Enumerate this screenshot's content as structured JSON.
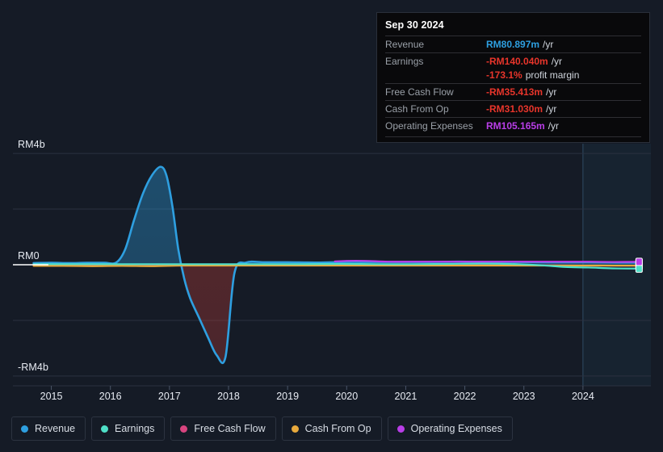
{
  "chart_data": {
    "type": "area",
    "title": "",
    "xlabel": "",
    "ylabel": "",
    "currency_prefix": "RM",
    "xlim": [
      2014.35,
      2025.15
    ],
    "ylim": [
      -4.35,
      4.35
    ],
    "y_unit": "b",
    "grid": true,
    "legend_position": "bottom",
    "y_ticks": [
      {
        "value": 4,
        "label": "RM4b"
      },
      {
        "value": 2,
        "label": ""
      },
      {
        "value": 0,
        "label": "RM0"
      },
      {
        "value": -2,
        "label": ""
      },
      {
        "value": -4,
        "label": "-RM4b"
      }
    ],
    "x_ticks": [
      {
        "value": 2015,
        "label": "2015"
      },
      {
        "value": 2016,
        "label": "2016"
      },
      {
        "value": 2017,
        "label": "2017"
      },
      {
        "value": 2018,
        "label": "2018"
      },
      {
        "value": 2019,
        "label": "2019"
      },
      {
        "value": 2020,
        "label": "2020"
      },
      {
        "value": 2021,
        "label": "2021"
      },
      {
        "value": 2022,
        "label": "2022"
      },
      {
        "value": 2023,
        "label": "2023"
      },
      {
        "value": 2024,
        "label": "2024"
      }
    ],
    "forecast_start": 2024.0,
    "series": [
      {
        "name": "Revenue",
        "color": "#2e9fe0",
        "filled": true,
        "x": [
          2014.7,
          2015.0,
          2015.3,
          2015.6,
          2015.9,
          2016.1,
          2016.25,
          2016.4,
          2016.55,
          2016.7,
          2016.85,
          2016.95,
          2017.05,
          2017.15,
          2017.25,
          2017.35,
          2017.5,
          2017.65,
          2017.8,
          2017.95,
          2018.1,
          2018.3,
          2018.6,
          2019.0,
          2019.5,
          2020.0,
          2020.4,
          2020.9,
          2021.4,
          2021.9,
          2022.4,
          2022.9,
          2023.4,
          2023.9,
          2024.2,
          2024.6,
          2024.95
        ],
        "y": [
          0.06,
          0.07,
          0.06,
          0.07,
          0.07,
          0.08,
          0.55,
          1.6,
          2.55,
          3.2,
          3.52,
          3.2,
          2.1,
          0.55,
          -0.5,
          -1.2,
          -1.9,
          -2.6,
          -3.25,
          -3.3,
          -0.3,
          0.08,
          0.09,
          0.09,
          0.08,
          0.1,
          0.1,
          0.1,
          0.1,
          0.11,
          0.1,
          0.1,
          0.09,
          0.09,
          0.09,
          0.08,
          0.081
        ]
      },
      {
        "name": "Earnings",
        "color": "#4fe0c8",
        "filled": false,
        "x": [
          2014.7,
          2015.4,
          2016.0,
          2016.6,
          2017.1,
          2017.6,
          2018.1,
          2018.7,
          2019.3,
          2019.9,
          2020.5,
          2021.1,
          2021.7,
          2022.3,
          2022.9,
          2023.3,
          2023.7,
          2024.1,
          2024.5,
          2024.95
        ],
        "y": [
          0.02,
          0.02,
          0.02,
          0.02,
          0.02,
          0.02,
          0.02,
          0.02,
          0.02,
          0.03,
          0.02,
          0.02,
          0.03,
          0.04,
          0.02,
          -0.02,
          -0.08,
          -0.1,
          -0.13,
          -0.14
        ]
      },
      {
        "name": "Free Cash Flow",
        "color": "#d8447f",
        "filled": false,
        "x": [
          2014.7,
          2015.5,
          2016.3,
          2017.0,
          2017.8,
          2018.5,
          2019.3,
          2020.1,
          2020.9,
          2021.7,
          2022.5,
          2023.2,
          2023.8,
          2024.3,
          2024.95
        ],
        "y": [
          -0.03,
          -0.03,
          -0.04,
          -0.03,
          -0.02,
          -0.02,
          -0.02,
          -0.02,
          -0.02,
          -0.02,
          -0.02,
          -0.02,
          -0.03,
          -0.03,
          -0.035
        ]
      },
      {
        "name": "Cash From Op",
        "color": "#e8a93c",
        "filled": false,
        "x": [
          2014.7,
          2015.2,
          2015.7,
          2016.2,
          2016.7,
          2017.2,
          2017.7,
          2018.2,
          2018.8,
          2019.4,
          2020.0,
          2020.6,
          2021.2,
          2021.8,
          2022.4,
          2023.0,
          2023.6,
          2024.2,
          2024.95
        ],
        "y": [
          -0.04,
          -0.04,
          -0.05,
          -0.04,
          -0.05,
          -0.03,
          -0.03,
          -0.03,
          -0.03,
          -0.03,
          -0.03,
          -0.03,
          -0.03,
          -0.03,
          -0.03,
          -0.03,
          -0.03,
          -0.03,
          -0.031
        ]
      },
      {
        "name": "Operating Expenses",
        "color": "#b93ee8",
        "filled": false,
        "x": [
          2019.8,
          2020.0,
          2020.3,
          2020.7,
          2021.1,
          2021.6,
          2022.1,
          2022.6,
          2023.1,
          2023.6,
          2024.1,
          2024.5,
          2024.95
        ],
        "y": [
          0.12,
          0.14,
          0.14,
          0.11,
          0.11,
          0.11,
          0.11,
          0.11,
          0.11,
          0.11,
          0.11,
          0.1,
          0.105
        ]
      }
    ]
  },
  "tooltip": {
    "date": "Sep 30 2024",
    "rows": [
      {
        "label": "Revenue",
        "value": "RM80.897m",
        "unit": "/yr",
        "color": "#2e9fe0"
      },
      {
        "label": "Earnings",
        "value": "-RM140.040m",
        "unit": "/yr",
        "color": "#e8352b"
      },
      {
        "label": "",
        "value": "-173.1%",
        "unit": "profit margin",
        "color": "#e8352b"
      },
      {
        "label": "Free Cash Flow",
        "value": "-RM35.413m",
        "unit": "/yr",
        "color": "#e8352b"
      },
      {
        "label": "Cash From Op",
        "value": "-RM31.030m",
        "unit": "/yr",
        "color": "#e8352b"
      },
      {
        "label": "Operating Expenses",
        "value": "RM105.165m",
        "unit": "/yr",
        "color": "#b93ee8"
      }
    ]
  },
  "legend": {
    "items": [
      {
        "label": "Revenue",
        "color": "#2e9fe0"
      },
      {
        "label": "Earnings",
        "color": "#4fe0c8"
      },
      {
        "label": "Free Cash Flow",
        "color": "#d8447f"
      },
      {
        "label": "Cash From Op",
        "color": "#e8a93c"
      },
      {
        "label": "Operating Expenses",
        "color": "#b93ee8"
      }
    ]
  },
  "colors": {
    "background": "#151b26",
    "gridline": "#2b3240",
    "zero_line": "#ffffff",
    "forecast_band": "#172330",
    "forecast_divider": "#2e4a63"
  }
}
